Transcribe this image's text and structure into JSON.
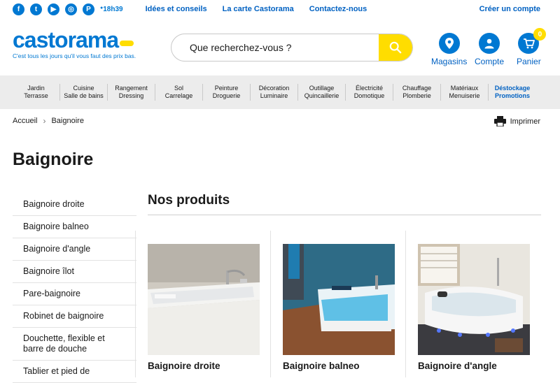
{
  "topbar": {
    "social": [
      "f",
      "t",
      "▶",
      "◎",
      "P"
    ],
    "clock": "18h39",
    "links": [
      "Idées et conseils",
      "La carte Castorama",
      "Contactez-nous"
    ],
    "account_link": "Créer un compte"
  },
  "header": {
    "logo": "castorama",
    "tagline": "C'est tous les jours qu'il vous faut des prix bas.",
    "search_placeholder": "Que recherchez-vous ?",
    "stores_label": "Magasins",
    "account_label": "Compte",
    "cart_label": "Panier",
    "cart_count": "0"
  },
  "nav": [
    {
      "l1": "Jardin",
      "l2": "Terrasse"
    },
    {
      "l1": "Cuisine",
      "l2": "Salle de bains"
    },
    {
      "l1": "Rangement",
      "l2": "Dressing"
    },
    {
      "l1": "Sol",
      "l2": "Carrelage"
    },
    {
      "l1": "Peinture",
      "l2": "Droguerie"
    },
    {
      "l1": "Décoration",
      "l2": "Luminaire"
    },
    {
      "l1": "Outillage",
      "l2": "Quincaillerie"
    },
    {
      "l1": "Électricité",
      "l2": "Domotique"
    },
    {
      "l1": "Chauffage",
      "l2": "Plomberie"
    },
    {
      "l1": "Matériaux",
      "l2": "Menuiserie"
    },
    {
      "l1": "Déstockage",
      "l2": "Promotions"
    }
  ],
  "breadcrumb": {
    "home": "Accueil",
    "current": "Baignoire"
  },
  "print_label": "Imprimer",
  "page_title": "Baignoire",
  "sidebar": [
    "Baignoire droite",
    "Baignoire balneo",
    "Baignoire d'angle",
    "Baignoire îlot",
    "Pare-baignoire",
    "Robinet de baignoire",
    "Douchette, flexible et barre de douche",
    "Tablier et pied de"
  ],
  "section_title": "Nos produits",
  "products": [
    {
      "name": "Baignoire droite"
    },
    {
      "name": "Baignoire balneo"
    },
    {
      "name": "Baignoire d'angle"
    }
  ],
  "colors": {
    "brand_blue": "#0078d2",
    "brand_yellow": "#ffdd00"
  }
}
